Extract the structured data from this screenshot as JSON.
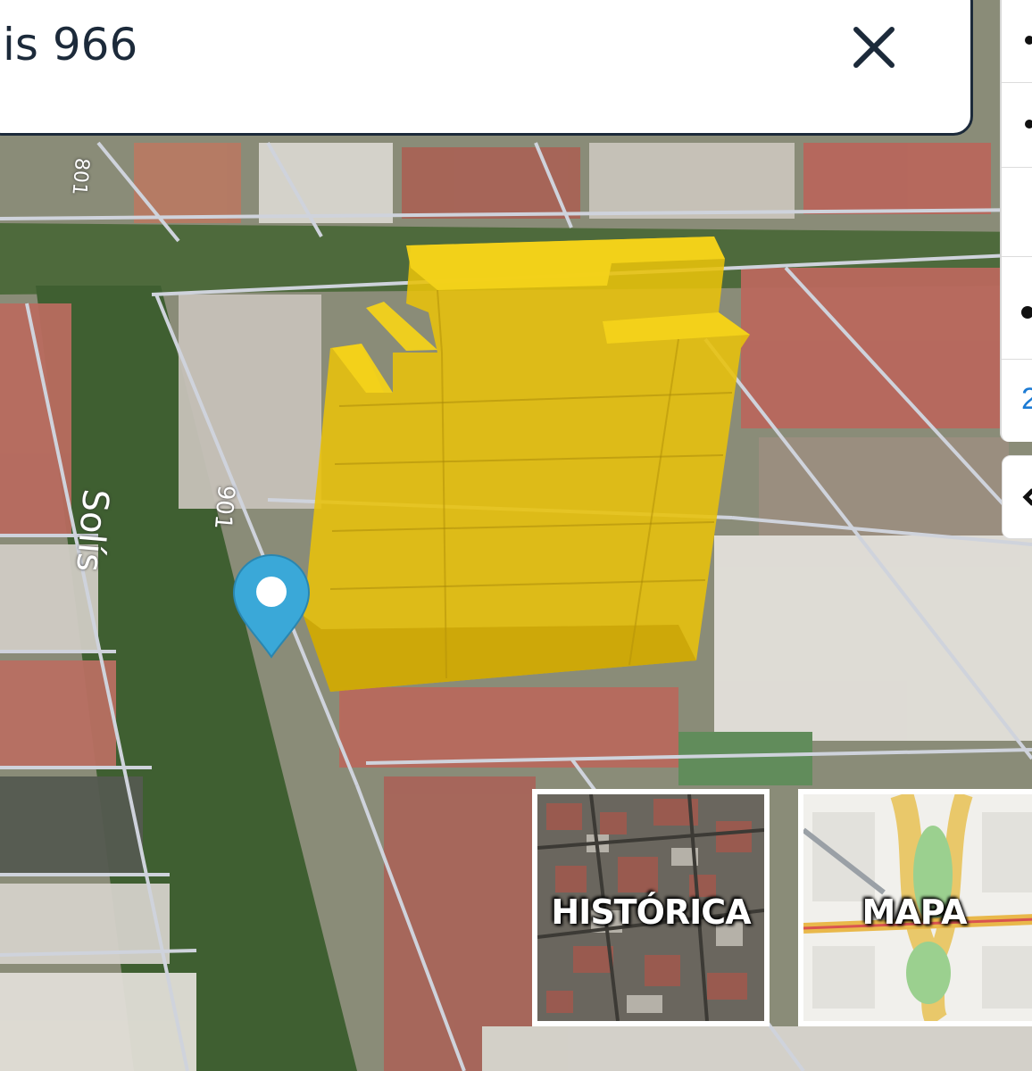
{
  "search": {
    "value": "is 966"
  },
  "side_panel": {
    "visible_number": "2"
  },
  "map_labels": {
    "street_name": "Solís",
    "street_number_top": "801",
    "street_number_mid": "901"
  },
  "layers": [
    {
      "label": "HISTÓRICA"
    },
    {
      "label": "MAPA"
    }
  ],
  "colors": {
    "building_extrusion": "#e8c20a",
    "pin": "#3aa8d8",
    "search_border": "#1c2a3a",
    "parcel_lines": "#cfd3dc"
  }
}
